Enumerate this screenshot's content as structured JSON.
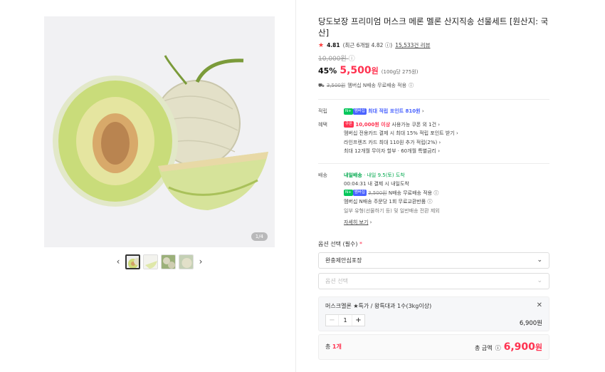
{
  "gallery": {
    "counter": "1/4",
    "prev": "‹",
    "next": "›"
  },
  "product": {
    "title": "당도보장 프리미엄 머스크 메론 멜론 산지직송 선물세트 [원산지: 국산]",
    "rating": "4.81",
    "rating_detail": "(최근 6개월 4.82",
    "rating_detail_end": ")",
    "reviews": "15,533건 리뷰",
    "original_price": "10,000원",
    "discount": "45%",
    "price": "5,500",
    "price_unit": "원",
    "unit_price": "(100g당 275원)",
    "shipping_strike": "3,500원",
    "shipping_text": "멤버십 N배송 무료배송 적용"
  },
  "benefits": {
    "label_points": "적립",
    "npay_badge": "N+",
    "plus_badge": "멤버십",
    "points_text": "최대 적립 포인트 810원",
    "label_benefit": "혜택",
    "coupon_badge": "쿠폰",
    "coupon_strong": "10,000원 이상",
    "coupon_text": "사용가능 쿠폰 외 1건",
    "card1": "멤버십 전용카드 결제 시 최대 15% 적립 포인트 받기",
    "card2": "라인프렌즈 카드 최대 110원 추가 적립(2%)",
    "card3": "최대 12개월 무이자 할부 · 60개월 특별금리"
  },
  "delivery": {
    "label": "배송",
    "tomorrow": "내일배송",
    "arrival": "내일 9.5(토) 도착",
    "timer": "00:04:31 내 결제 시 내일도착",
    "free_strike": "3,500원",
    "free_text": "N배송 무료배송 적용",
    "exchange": "멤버십 N배송 주문당 1회 무료교환반품",
    "exclude": "일부 유형(선물하기 등) 및 일반배송 전환 제외",
    "more": "자세히 보기"
  },
  "options": {
    "label": "옵션 선택 (필수)",
    "req": "*",
    "select1": "완충제안심포장",
    "select2": "옵션 선택"
  },
  "cart": {
    "item_name": "머스크멜론 ★특가 / 왕특대과 1수(3kg이상)",
    "qty": "1",
    "minus": "−",
    "plus": "+",
    "item_price": "6,900원"
  },
  "total": {
    "count_prefix": "총 ",
    "count": "1개",
    "label": "총 금액",
    "price": "6,900",
    "unit": "원"
  }
}
